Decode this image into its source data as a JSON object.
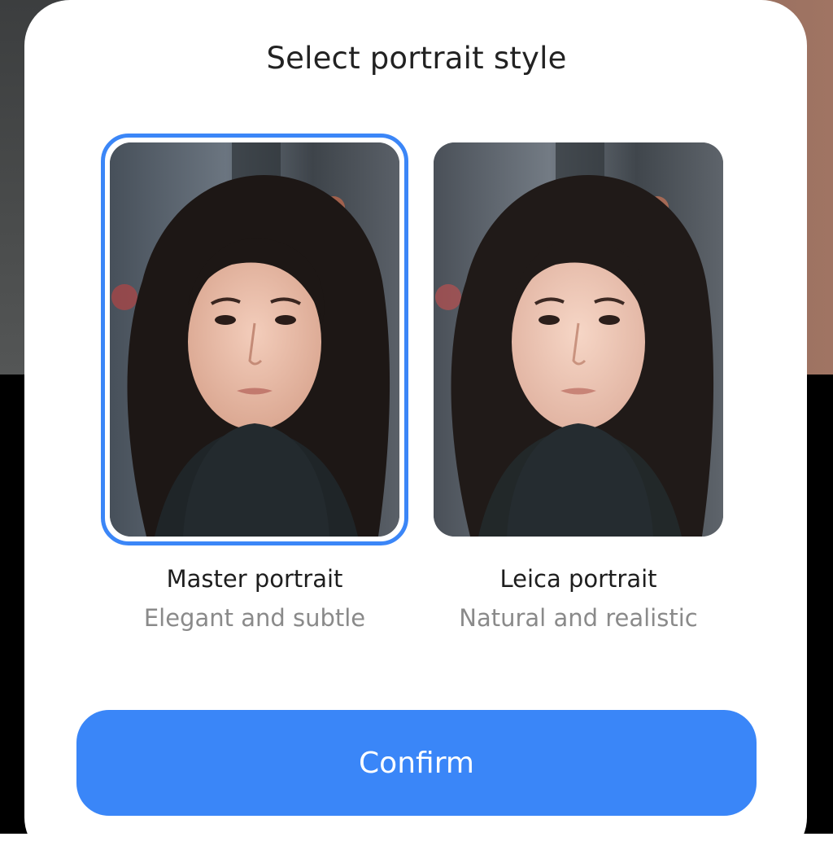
{
  "dialog": {
    "title": "Select portrait style",
    "options": [
      {
        "label": "Master portrait",
        "subtitle": "Elegant and subtle",
        "selected": true
      },
      {
        "label": "Leica portrait",
        "subtitle": "Natural and realistic",
        "selected": false
      }
    ],
    "confirm_label": "Confirm"
  },
  "colors": {
    "accent": "#3a86f8",
    "sheet_background": "#ffffff",
    "title_text": "#222222",
    "subtitle_text": "#8a8a8a"
  },
  "images": {
    "option_1_photo": "portrait-woman-dark-hair-black-scarf",
    "option_2_photo": "portrait-woman-dark-hair-black-scarf"
  }
}
